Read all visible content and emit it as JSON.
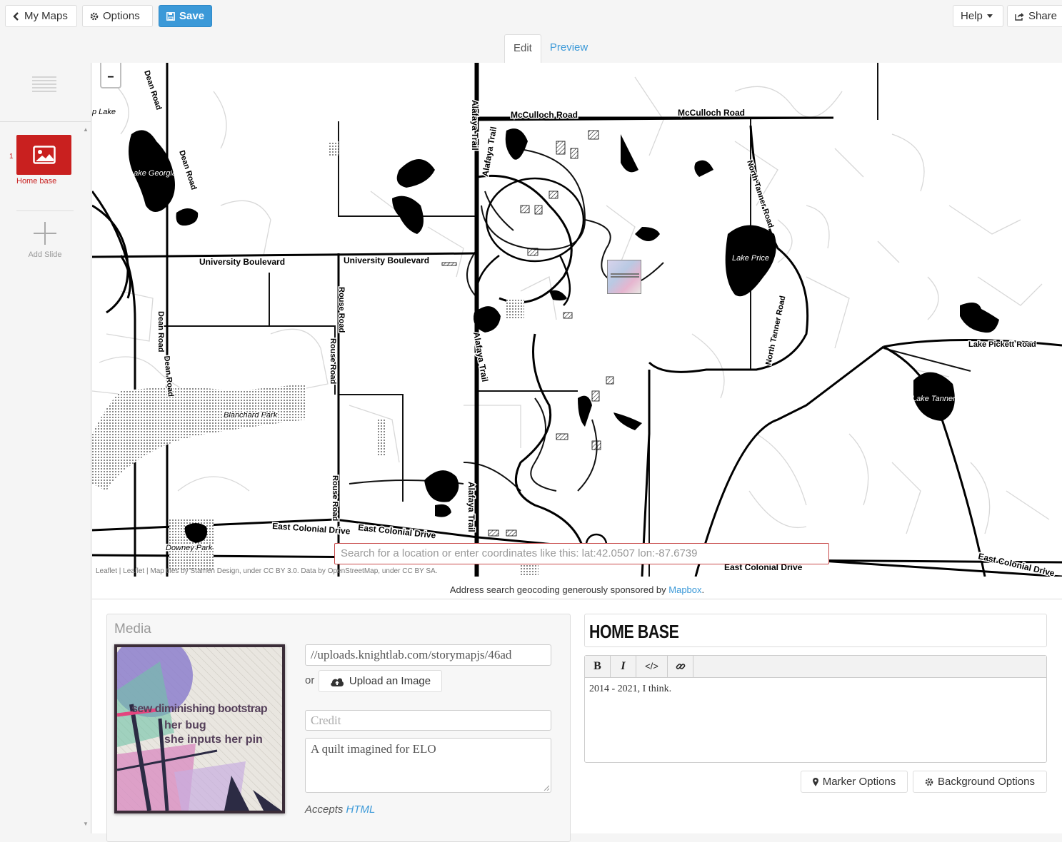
{
  "toolbar": {
    "my_maps": "My Maps",
    "options": "Options",
    "save": "Save",
    "help": "Help",
    "share": "Share"
  },
  "tabs": {
    "edit": "Edit",
    "preview": "Preview"
  },
  "sidebar": {
    "slides": [
      {
        "number": "1",
        "label": "Home base"
      }
    ],
    "add_slide": "Add Slide"
  },
  "map": {
    "zoom_out": "−",
    "labels": {
      "mcculloch_1": "McCulloch Road",
      "mcculloch_2": "McCulloch Road",
      "university_1": "University Boulevard",
      "university_2": "University Boulevard",
      "alafaya_1": "Alafaya Trail",
      "alafaya_2": "Alafaya Trail",
      "alafaya_3": "Alafaya Trail",
      "alafaya_4": "Alafaya Trail",
      "dean_1": "Dean Road",
      "dean_2": "Dean Road",
      "dean_3": "Dean Road",
      "dean_4": "Dean Road",
      "rouse_1": "Rouse Road",
      "rouse_2": "Rouse Road",
      "rouse_3": "Rouse Road",
      "north_tanner_1": "North Tanner Road",
      "north_tanner_2": "North Tanner Road",
      "lake_pickett": "Lake Pickett Road",
      "east_colonial_1": "East Colonial Drive",
      "east_colonial_2": "East Colonial Drive",
      "east_colonial_3": "East Colonial Drive",
      "east_colonial_4": "East Colonial Drive",
      "lake_georgia": "Lake Georgia",
      "lake_price": "Lake Price",
      "lake_tanner": "Lake Tanner",
      "blanchard_park": "Blanchard Park",
      "downey_park": "Downey Park",
      "lake_partial": "p Lake"
    },
    "attribution": {
      "leaflet": "Leaflet",
      "sep": " | ",
      "tiles_prefix": "Map tiles by ",
      "stamen": "Stamen Design",
      "under1": ", under ",
      "cc3": "CC BY 3.0",
      "data_by": ". Data by ",
      "osm": "OpenStreetMap",
      "under2": ", under ",
      "ccsa": "CC BY SA",
      "end": "."
    },
    "search_placeholder": "Search for a location or enter coordinates like this: lat:42.0507 lon:-87.6739"
  },
  "sponsor": {
    "text": "Address search geocoding generously sponsored by ",
    "link": "Mapbox",
    "end": "."
  },
  "media": {
    "title": "Media",
    "url_value": "//uploads.knightlab.com/storymapjs/46ad",
    "or": "or",
    "upload_button": "Upload an Image",
    "credit_placeholder": "Credit",
    "caption_value": "A quilt imagined for ELO",
    "accepts": "Accepts ",
    "html_link": "HTML",
    "image_text": [
      "sew diminishing bootstrap",
      "her bug",
      "she inputs her pin"
    ]
  },
  "text_panel": {
    "headline": "HOME BASE",
    "rte_buttons": [
      "B",
      "I",
      "</>"
    ],
    "body": "2014 - 2021, I think."
  },
  "options": {
    "marker": "Marker Options",
    "background": "Background Options"
  },
  "colors": {
    "accent": "#3b99d8",
    "slide_red": "#c9201f",
    "error_border": "#c94c4c"
  }
}
